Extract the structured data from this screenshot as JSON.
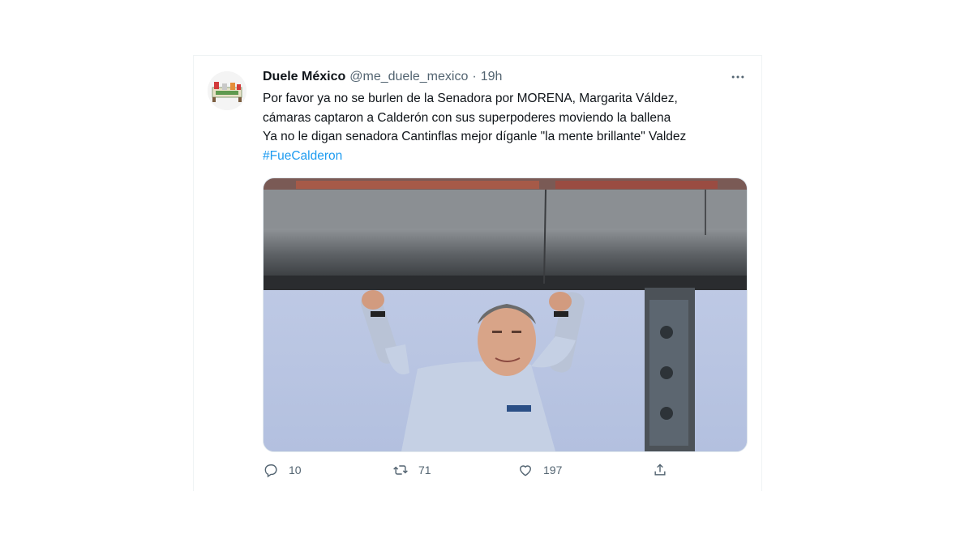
{
  "tweet": {
    "author_name": "Duele México",
    "handle": "@me_duele_mexico",
    "separator": "·",
    "time": "19h",
    "lines": [
      "Por favor  ya no se burlen de la Senadora por MORENA, Margarita Váldez,",
      "cámaras captaron a Calderón con sus superpoderes moviendo la ballena",
      "Ya no le digan senadora Cantinflas mejor díganle \"la mente brillante\" Valdez"
    ],
    "hashtag": "#FueCalderon"
  },
  "actions": {
    "reply_count": "10",
    "retweet_count": "71",
    "like_count": "197"
  },
  "icons": {
    "more": "more-horizontal-icon",
    "reply": "reply-icon",
    "retweet": "retweet-icon",
    "like": "heart-icon",
    "share": "share-icon"
  },
  "colors": {
    "text": "#0f1419",
    "secondary": "#536471",
    "link": "#1d9bf0"
  }
}
